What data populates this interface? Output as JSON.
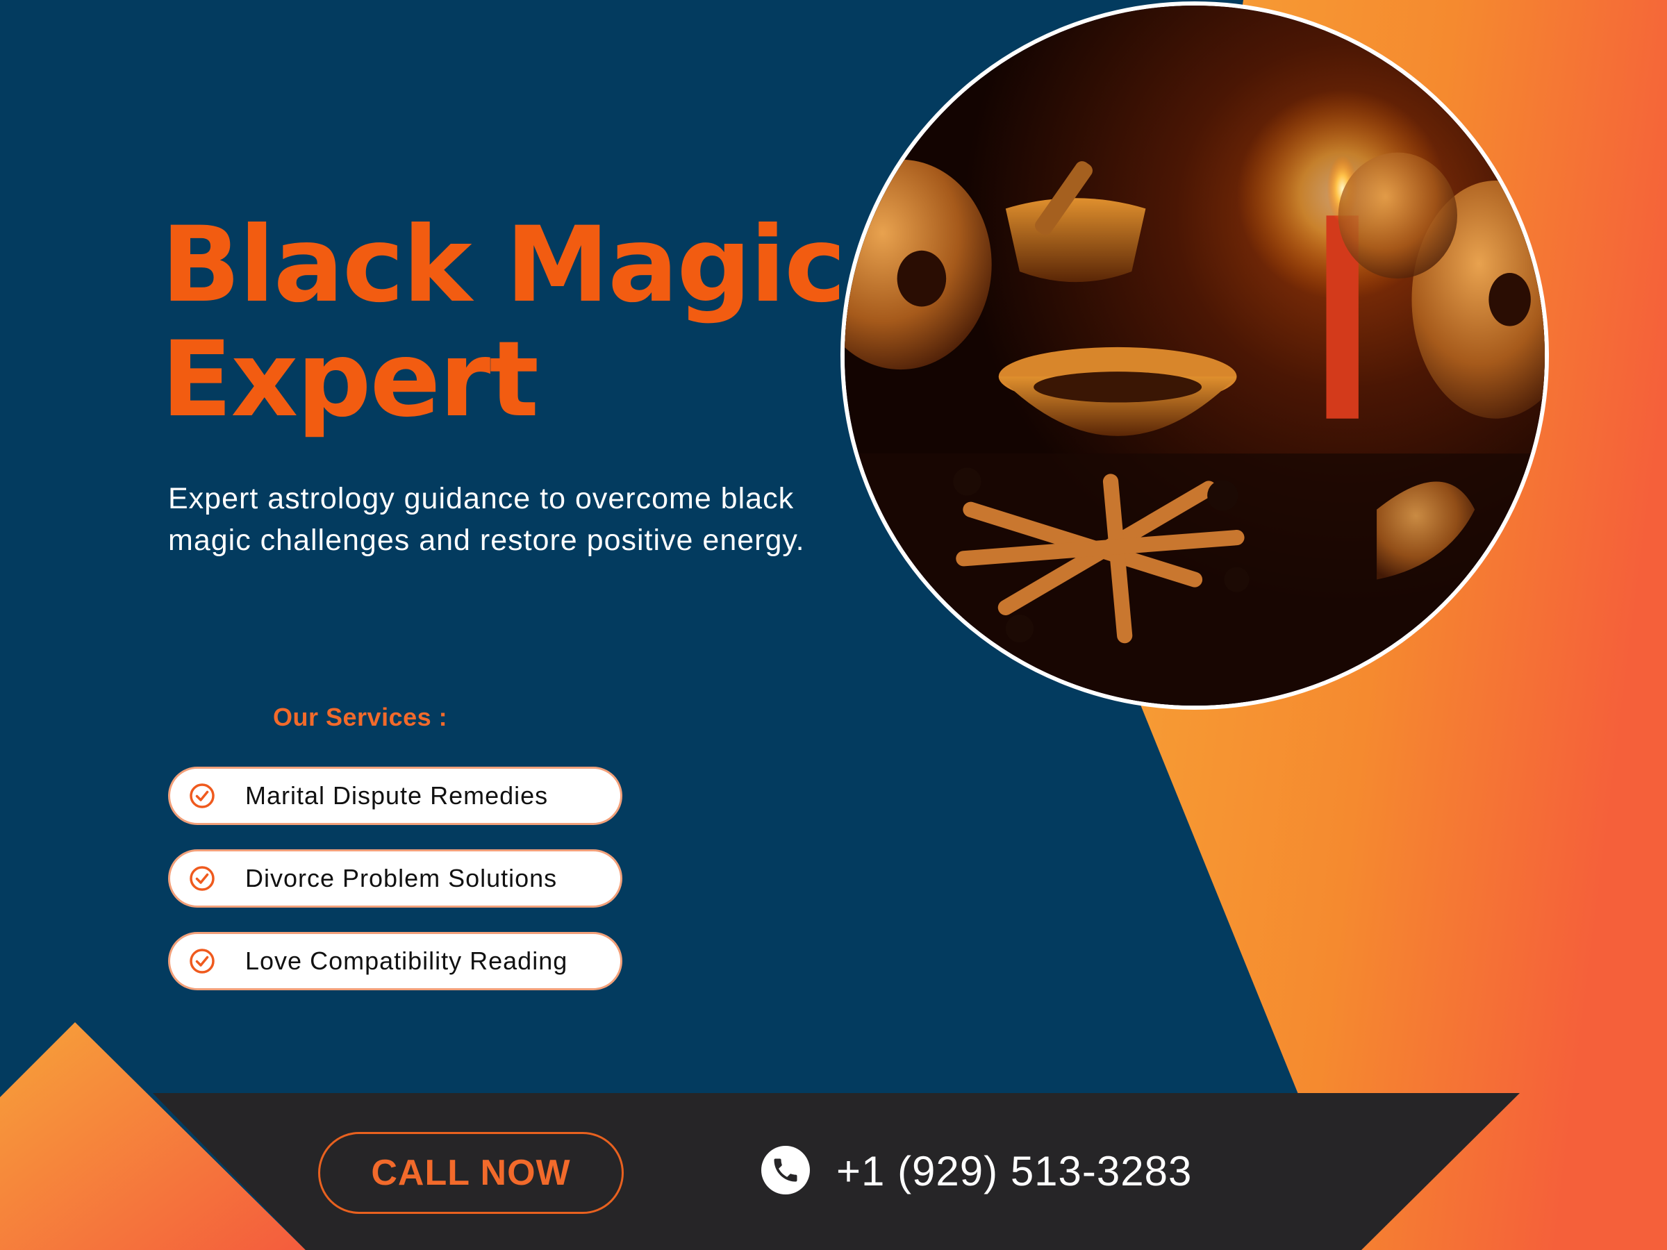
{
  "colors": {
    "background_navy": "#033b5f",
    "accent_orange": "#f25c11",
    "footer_bar": "#262527",
    "white": "#ffffff"
  },
  "hero": {
    "title_line1": "Black Magic",
    "title_line2": "Expert",
    "subtitle": "Expert astrology guidance to overcome black magic challenges and restore positive energy."
  },
  "services": {
    "heading": "Our Services :",
    "items": [
      {
        "label": "Marital Dispute Remedies",
        "icon": "check-circle-icon"
      },
      {
        "label": "Divorce Problem Solutions",
        "icon": "check-circle-icon"
      },
      {
        "label": "Love Compatibility Reading",
        "icon": "check-circle-icon"
      }
    ]
  },
  "footer": {
    "cta_label": "CALL NOW",
    "phone_icon": "phone-icon",
    "phone_number": "+1 (929) 513-3283"
  }
}
